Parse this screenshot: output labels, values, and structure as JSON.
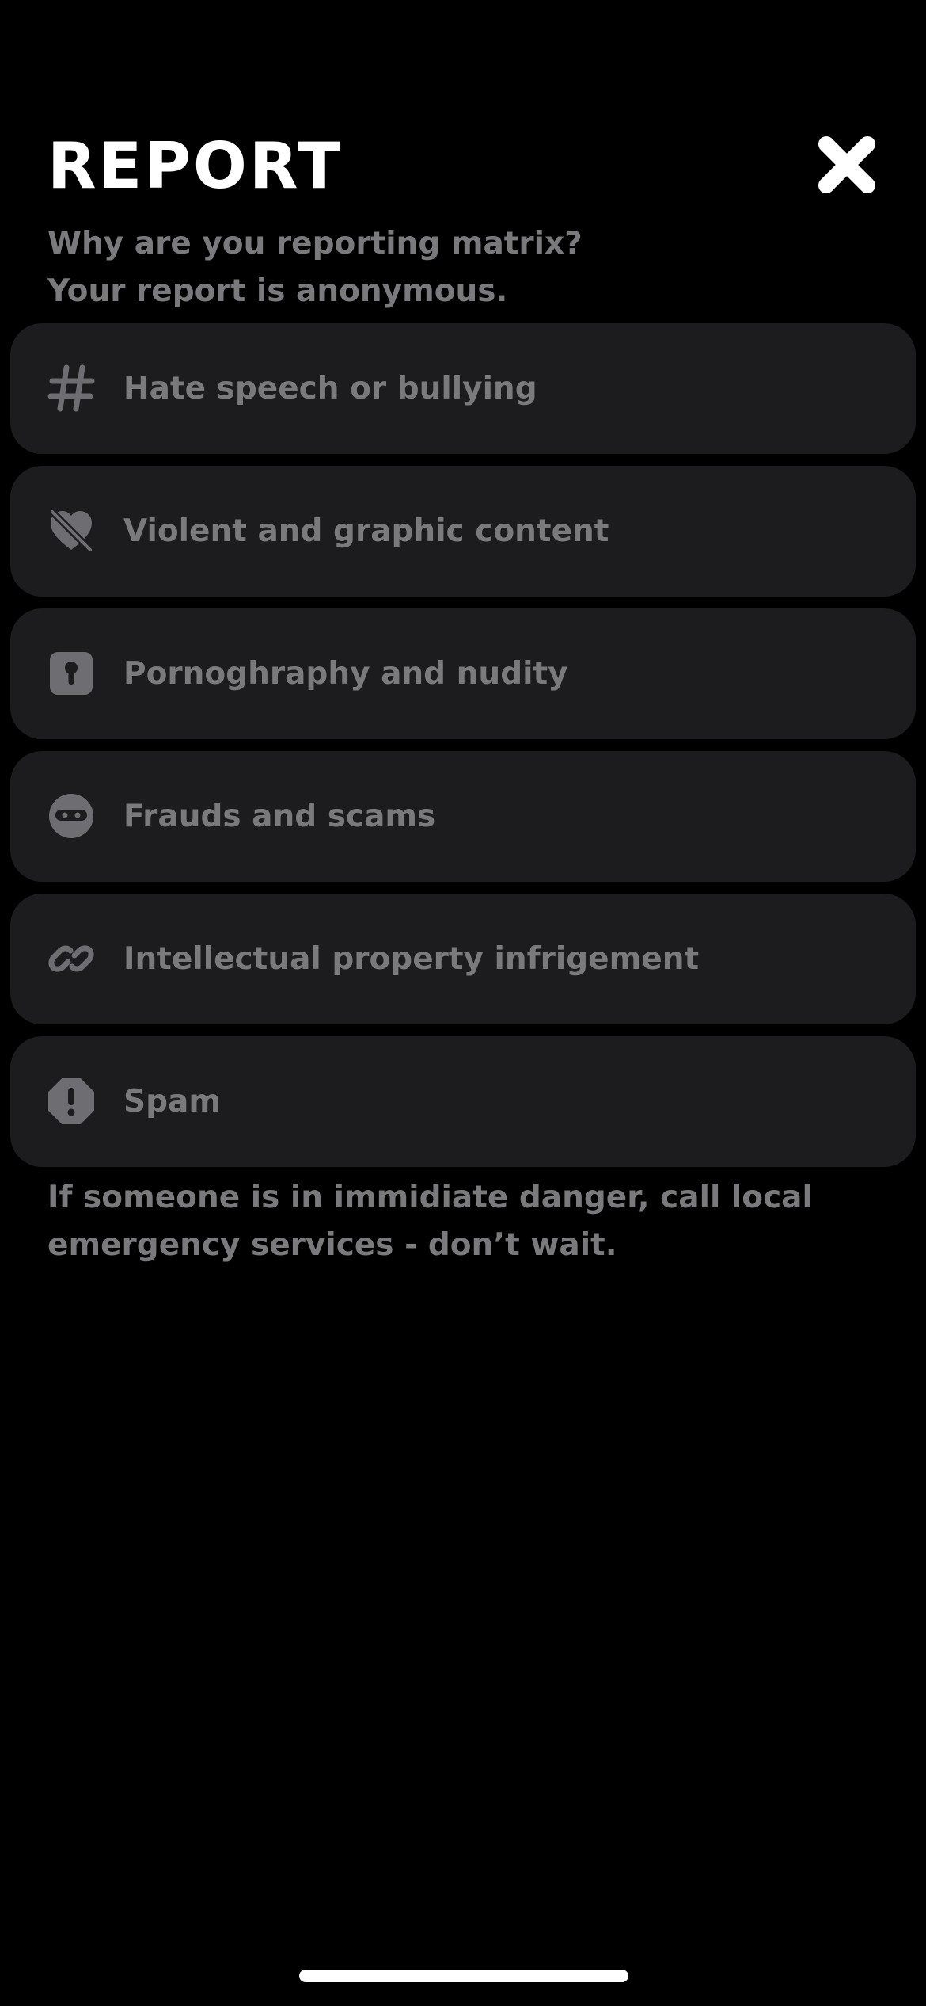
{
  "header": {
    "title": "REPORT",
    "close_icon": "close-icon"
  },
  "subtitle": {
    "line1": "Why are you reporting matrix?",
    "line2": "Your report is anonymous."
  },
  "options": [
    {
      "label": "Hate speech or bullying",
      "icon": "hashtag-icon"
    },
    {
      "label": "Violent and graphic content",
      "icon": "broken-heart-icon"
    },
    {
      "label": "Pornoghraphy and nudity",
      "icon": "keyhole-icon"
    },
    {
      "label": "Frauds and scams",
      "icon": "masked-face-icon"
    },
    {
      "label": "Intellectual property infrigement",
      "icon": "link-icon"
    },
    {
      "label": "Spam",
      "icon": "exclamation-icon"
    }
  ],
  "warning": {
    "line1": "If someone is in immidiate danger, call local",
    "line2": "emergency services - don’t wait."
  },
  "colors": {
    "background": "#000000",
    "card": "#1c1c1e",
    "muted_text": "#7a7a7d",
    "title": "#ffffff"
  }
}
